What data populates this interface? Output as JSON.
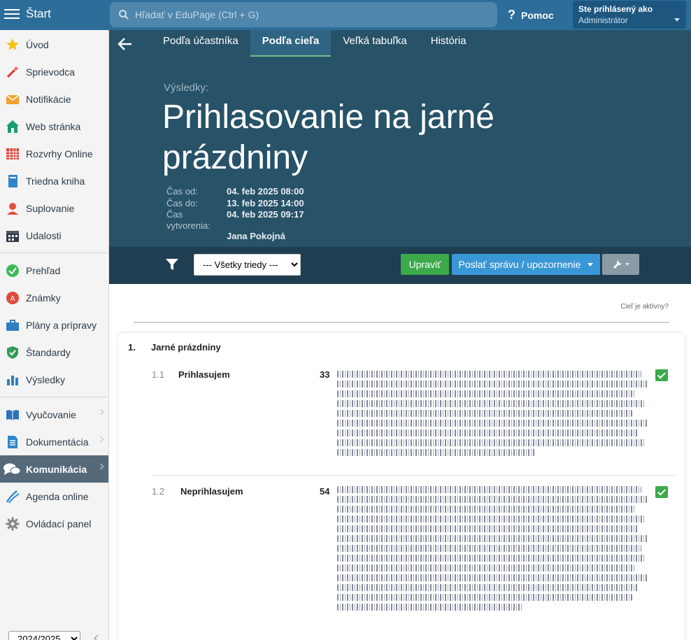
{
  "topbar": {
    "start_label": "Štart",
    "search_placeholder": "Hľadať v EduPage (Ctrl + G)",
    "help_label": "Pomoc",
    "login_line1": "Ste prihlásený ako",
    "login_line2": "Administrátor"
  },
  "sidebar": {
    "items": [
      {
        "label": "Úvod",
        "icon": "star-icon"
      },
      {
        "label": "Sprievodca",
        "icon": "magic-wand-icon"
      },
      {
        "label": "Notifikácie",
        "icon": "envelope-icon"
      },
      {
        "label": "Web stránka",
        "icon": "home-icon"
      },
      {
        "label": "Rozvrhy Online",
        "icon": "timetable-icon"
      },
      {
        "label": "Triedna kniha",
        "icon": "book-icon"
      },
      {
        "label": "Suplovanie",
        "icon": "person-icon"
      },
      {
        "label": "Udalosti",
        "icon": "calendar-icon"
      },
      {
        "label": "Prehľad",
        "icon": "check-circle-icon"
      },
      {
        "label": "Známky",
        "icon": "grade-icon"
      },
      {
        "label": "Plány a prípravy",
        "icon": "briefcase-icon"
      },
      {
        "label": "Štandardy",
        "icon": "shield-check-icon"
      },
      {
        "label": "Výsledky",
        "icon": "bar-chart-icon"
      },
      {
        "label": "Vyučovanie",
        "icon": "open-book-icon"
      },
      {
        "label": "Dokumentácia",
        "icon": "document-icon"
      },
      {
        "label": "Komunikácia",
        "icon": "chat-icon"
      },
      {
        "label": "Agenda online",
        "icon": "pen-icon"
      },
      {
        "label": "Ovládací panel",
        "icon": "gear-icon"
      }
    ],
    "year": "2024/2025"
  },
  "tabs": [
    "Podľa účastníka",
    "Podľa cieľa",
    "Veľká tabuľka",
    "História"
  ],
  "header": {
    "results_label": "Výsledky:",
    "title": "Prihlasovanie na jarné prázdniny",
    "meta": [
      {
        "key": "Čas od:",
        "value": "04. feb 2025 08:00"
      },
      {
        "key": "Čas do:",
        "value": "13. feb 2025 14:00"
      },
      {
        "key": "Čas vytvorenia:",
        "value": "04. feb 2025 09:17"
      },
      {
        "key": "",
        "value": "Jana Pokojná"
      }
    ]
  },
  "toolbar": {
    "class_filter": "--- Všetky triedy ---",
    "edit_label": "Upraviť",
    "send_label": "Poslať správu / upozornenie"
  },
  "content": {
    "goal_active": "Cieľ je aktívny?",
    "section_num": "1.",
    "section_title": "Jarné prázdniny",
    "options": [
      {
        "num": "1.1",
        "label": "Prihlasujem",
        "count": "33"
      },
      {
        "num": "1.2",
        "label": "Neprihlasujem",
        "count": "54"
      }
    ]
  },
  "colors": {
    "topbar": "#2c6d9a",
    "header_bg": "#275268",
    "toolbar_bg": "#1f3e52",
    "green": "#3ca94a",
    "blue": "#3a97d6"
  }
}
